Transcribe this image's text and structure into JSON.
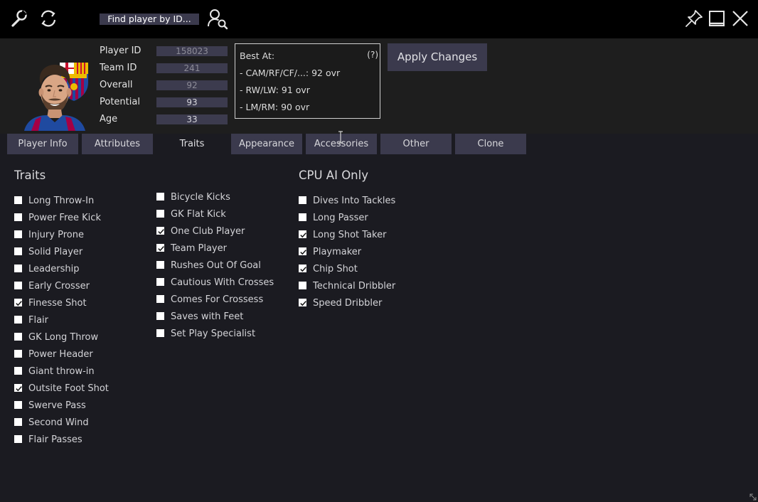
{
  "topbar": {
    "search_button": "Find player by ID...",
    "icons": [
      "wrench-icon",
      "refresh-icon",
      "user-search-icon",
      "pin-icon",
      "minimize-icon",
      "close-icon"
    ]
  },
  "player": {
    "fields": [
      {
        "label": "Player ID",
        "value": "158023"
      },
      {
        "label": "Team ID",
        "value": "241"
      },
      {
        "label": "Overall",
        "value": "92"
      },
      {
        "label": "Potential",
        "value": "93"
      },
      {
        "label": "Age",
        "value": "33"
      }
    ]
  },
  "best_at": {
    "title": "Best At:",
    "help": "(?)",
    "lines": [
      "- CAM/RF/CF/...: 92 ovr",
      "- RW/LW: 91 ovr",
      "- LM/RM: 90 ovr"
    ]
  },
  "apply_button": "Apply Changes",
  "tabs": [
    {
      "label": "Player Info",
      "active": false
    },
    {
      "label": "Attributes",
      "active": false
    },
    {
      "label": "Traits",
      "active": true
    },
    {
      "label": "Appearance",
      "active": false
    },
    {
      "label": "Accessories",
      "active": false
    },
    {
      "label": "Other",
      "active": false
    },
    {
      "label": "Clone",
      "active": false
    }
  ],
  "traits": {
    "title": "Traits",
    "col1": [
      {
        "label": "Long Throw-In",
        "checked": false
      },
      {
        "label": "Power Free Kick",
        "checked": false
      },
      {
        "label": "Injury Prone",
        "checked": false
      },
      {
        "label": "Solid Player",
        "checked": false
      },
      {
        "label": "Leadership",
        "checked": false
      },
      {
        "label": "Early Crosser",
        "checked": false
      },
      {
        "label": "Finesse Shot",
        "checked": true
      },
      {
        "label": "Flair",
        "checked": false
      },
      {
        "label": "GK Long Throw",
        "checked": false
      },
      {
        "label": "Power Header",
        "checked": false
      },
      {
        "label": "Giant throw-in",
        "checked": false
      },
      {
        "label": "Outsite Foot Shot",
        "checked": true
      },
      {
        "label": "Swerve Pass",
        "checked": false
      },
      {
        "label": "Second Wind",
        "checked": false
      },
      {
        "label": "Flair Passes",
        "checked": false
      }
    ],
    "col2": [
      {
        "label": "Bicycle Kicks",
        "checked": false
      },
      {
        "label": "GK Flat Kick",
        "checked": false
      },
      {
        "label": "One Club Player",
        "checked": true
      },
      {
        "label": "Team Player",
        "checked": true
      },
      {
        "label": "Rushes Out Of Goal",
        "checked": false
      },
      {
        "label": "Cautious With Crosses",
        "checked": false
      },
      {
        "label": "Comes For Crossess",
        "checked": false
      },
      {
        "label": "Saves with Feet",
        "checked": false
      },
      {
        "label": "Set Play Specialist",
        "checked": false
      }
    ]
  },
  "cpu_ai": {
    "title": "CPU AI Only",
    "items": [
      {
        "label": "Dives Into Tackles",
        "checked": false
      },
      {
        "label": "Long Passer",
        "checked": false
      },
      {
        "label": "Long Shot Taker",
        "checked": true
      },
      {
        "label": "Playmaker",
        "checked": true
      },
      {
        "label": "Chip Shot",
        "checked": true
      },
      {
        "label": "Technical Dribbler",
        "checked": false
      },
      {
        "label": "Speed Dribbler",
        "checked": true
      }
    ]
  },
  "colors": {
    "background": "#1b1b21",
    "topbar": "#000000",
    "header": "#1e1e1e",
    "button": "#3b3a4d",
    "input": "#3c3b4e",
    "barca_blue": "#1f4aa0",
    "barca_red": "#a50044",
    "barca_yellow": "#edbb00"
  }
}
